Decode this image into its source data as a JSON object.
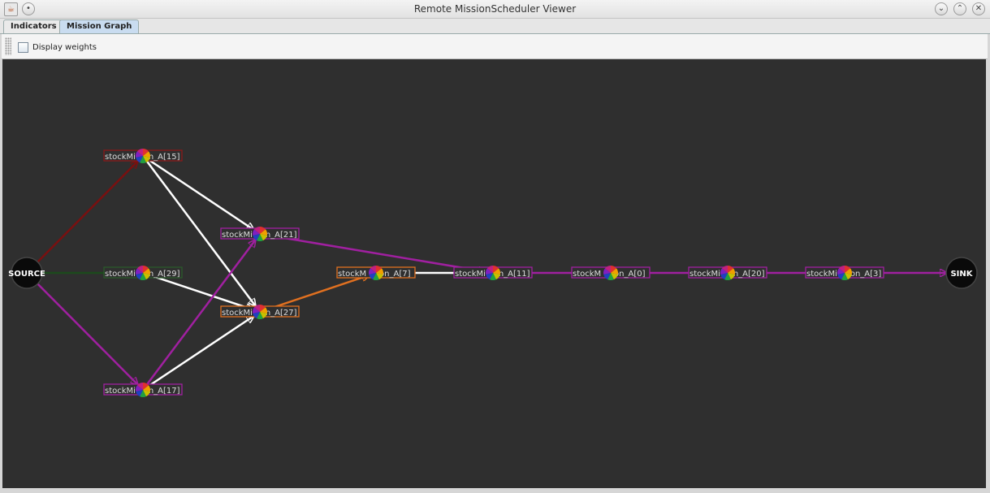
{
  "window": {
    "title": "Remote MissionScheduler Viewer"
  },
  "tabs": [
    {
      "label": "Indicators"
    },
    {
      "label": "Mission Graph"
    }
  ],
  "toolbar": {
    "display_weights_label": "Display weights",
    "display_weights_checked": false
  },
  "graph": {
    "terminals": [
      {
        "id": "source",
        "label": "SOURCE"
      },
      {
        "id": "sink",
        "label": "SINK"
      }
    ],
    "nodes": [
      {
        "id": "n15",
        "label": "stockMi     n_A[15]",
        "color": "#8b1a1a"
      },
      {
        "id": "n29",
        "label": "stockMi     n_A[29]",
        "color": "#2a5a2a"
      },
      {
        "id": "n17",
        "label": "stockMi     n_A[17]",
        "color": "#a020a0"
      },
      {
        "id": "n21",
        "label": "stockMi     n_A[21]",
        "color": "#a020a0"
      },
      {
        "id": "n27",
        "label": "stockMi     n_A[27]",
        "color": "#e07020"
      },
      {
        "id": "n7",
        "label": "stockM     on_A[7]",
        "color": "#e07020"
      },
      {
        "id": "n11",
        "label": "stockMi     n_A[11]",
        "color": "#a020a0"
      },
      {
        "id": "n0",
        "label": "stockM     on_A[0]",
        "color": "#a020a0"
      },
      {
        "id": "n20",
        "label": "stockMi     n_A[20]",
        "color": "#a020a0"
      },
      {
        "id": "n3",
        "label": "stockMi     on_A[3]",
        "color": "#a020a0"
      }
    ],
    "edges": [
      {
        "from": "source",
        "to": "n15",
        "color": "#7a1010"
      },
      {
        "from": "source",
        "to": "n29",
        "color": "#1c4a1c"
      },
      {
        "from": "source",
        "to": "n17",
        "color": "#a020a0"
      },
      {
        "from": "n15",
        "to": "n21",
        "color": "#ffffff"
      },
      {
        "from": "n15",
        "to": "n27",
        "color": "#ffffff"
      },
      {
        "from": "n29",
        "to": "n27",
        "color": "#ffffff"
      },
      {
        "from": "n17",
        "to": "n27",
        "color": "#ffffff"
      },
      {
        "from": "n17",
        "to": "n21",
        "color": "#a020a0"
      },
      {
        "from": "n21",
        "to": "n11",
        "color": "#a020a0"
      },
      {
        "from": "n27",
        "to": "n7",
        "color": "#e07020"
      },
      {
        "from": "n7",
        "to": "n11",
        "color": "#ffffff"
      },
      {
        "from": "n11",
        "to": "n0",
        "color": "#a020a0"
      },
      {
        "from": "n0",
        "to": "n20",
        "color": "#a020a0"
      },
      {
        "from": "n20",
        "to": "n3",
        "color": "#a020a0"
      },
      {
        "from": "n3",
        "to": "sink",
        "color": "#a020a0"
      }
    ]
  }
}
